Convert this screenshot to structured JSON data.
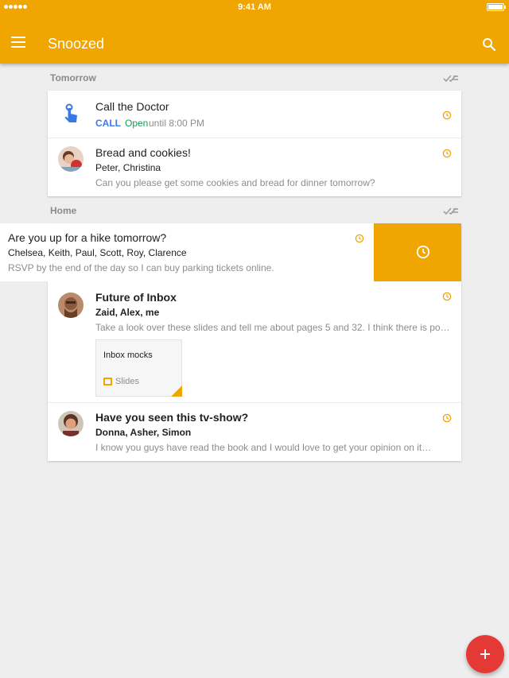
{
  "status_bar": {
    "time": "9:41 AM"
  },
  "app_bar": {
    "title": "Snoozed",
    "menu_icon": "hamburger-menu-icon",
    "search_icon": "search-icon"
  },
  "colors": {
    "primary": "#f0a500",
    "fab": "#e53935",
    "call": "#3b78e7",
    "open": "#0f9d58",
    "muted": "#8d8d8d"
  },
  "sections": [
    {
      "label": "Tomorrow",
      "mark_done_icon": "mark-done-icon",
      "items": [
        {
          "subject": "Call the Doctor",
          "action": "CALL",
          "status": "Open",
          "status_detail": "until 8:00 PM",
          "icon": "touch-hand-icon",
          "snooze_icon": "clock-icon"
        },
        {
          "subject": "Bread and cookies!",
          "senders": "Peter, Christina",
          "snippet": "Can you please get some cookies and bread for dinner tomorrow?",
          "snooze_icon": "clock-icon"
        }
      ]
    },
    {
      "label": "Home",
      "mark_done_icon": "mark-done-icon",
      "swiped_item": {
        "subject": "Are you up for a hike tomorrow?",
        "senders": "Chelsea, Keith, Paul, Scott, Roy, Clarence",
        "snippet": "RSVP by the end of the day so I can buy parking tickets online.",
        "snooze_icon": "clock-icon",
        "swipe_action_icon": "snooze-clock-icon"
      },
      "items": [
        {
          "subject": "Future of Inbox",
          "senders": "Zaid, Alex, me",
          "snippet": "Take a look over these slides and tell me about pages 5 and 32. I think there is poten…",
          "attachment": {
            "name": "Inbox mocks",
            "type": "Slides"
          },
          "snooze_icon": "clock-icon"
        },
        {
          "subject": "Have you seen this tv-show?",
          "senders": "Donna, Asher, Simon",
          "snippet": "I know you guys have read the book and I would love to get your opinion on it…",
          "snooze_icon": "clock-icon"
        }
      ]
    }
  ],
  "fab": {
    "icon": "plus-icon"
  }
}
